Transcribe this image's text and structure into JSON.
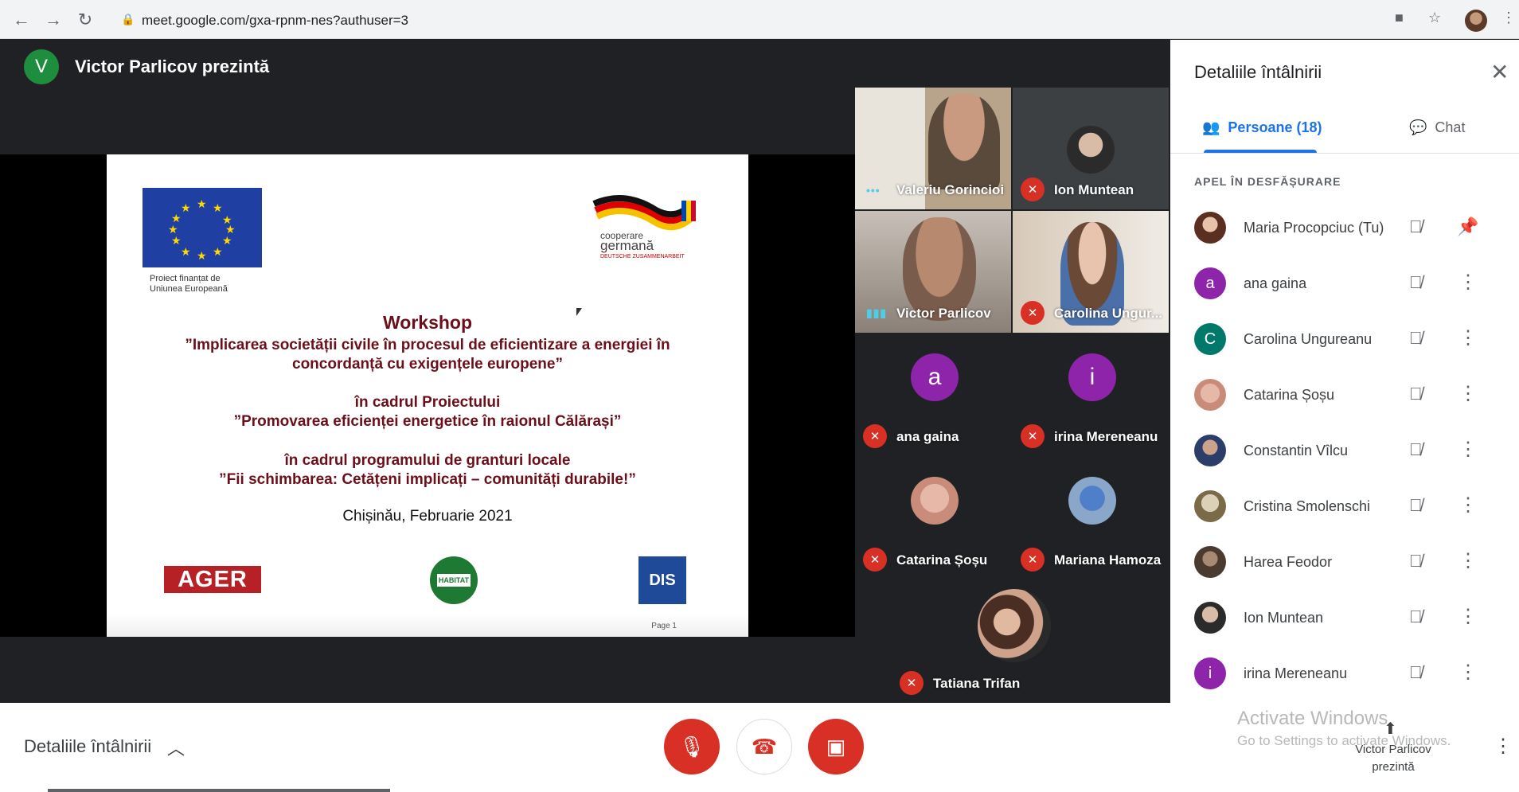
{
  "browser": {
    "url": "meet.google.com/gxa-rpnm-nes?authuser=3"
  },
  "presenter": {
    "initial": "V",
    "label": "Victor Parlicov prezintă"
  },
  "slide": {
    "eu_caption_line1": "Proiect finanțat de",
    "eu_caption_line2": "Uniunea Europeană",
    "ger_line1": "cooperare",
    "ger_line2": "germană",
    "ger_line3": "DEUTSCHE ZUSAMMENARBEIT",
    "workshop": "Workshop",
    "t1_line1": "”Implicarea societății civile în procesul de eficientizare a energiei în",
    "t1_line2": "concordanță cu exigențele europene”",
    "t2_line1": "în cadrul Proiectului",
    "t2_line2": "”Promovarea eficienței energetice în raionul Călărași”",
    "t3_line1": "în cadrul programului de granturi locale",
    "t3_line2": "”Fii schimbarea: Cetățeni implicați – comunități durabile!”",
    "date": "Chișinău, Februarie 2021",
    "logo_ager": "AGER",
    "logo_habitat": "HABITAT",
    "logo_dis": "DIS",
    "page": "Page 1"
  },
  "tiles": [
    {
      "name": "Valeriu Gorincioi"
    },
    {
      "name": "Ion Muntean"
    },
    {
      "name": "Victor Parlicov"
    },
    {
      "name": "Carolina Ungur..."
    },
    {
      "name": "ana gaina",
      "initial": "a"
    },
    {
      "name": "irina Mereneanu",
      "initial": "i"
    },
    {
      "name": "Catarina Șoșu"
    },
    {
      "name": "Mariana Hamoza"
    },
    {
      "name": "Tatiana Trifan"
    }
  ],
  "bottom": {
    "details_label": "Detaliile întâlnirii",
    "activate_title": "Activate Windows",
    "activate_sub": "Go to Settings to activate Windows.",
    "present_line1": "Victor Parlicov",
    "present_line2": "prezintă"
  },
  "panel": {
    "title": "Detaliile întâlnirii",
    "tab_people": "Persoane (18)",
    "tab_chat": "Chat",
    "section": "APEL ÎN DESFĂȘURARE",
    "people": [
      {
        "name": "Maria Procopciuc (Tu)"
      },
      {
        "name": "ana gaina",
        "initial": "a"
      },
      {
        "name": "Carolina Ungureanu",
        "initial": "C"
      },
      {
        "name": "Catarina Șoșu"
      },
      {
        "name": "Constantin Vîlcu"
      },
      {
        "name": "Cristina Smolenschi"
      },
      {
        "name": "Harea Feodor"
      },
      {
        "name": "Ion Muntean"
      },
      {
        "name": "irina Mereneanu",
        "initial": "i"
      }
    ]
  },
  "colors": {
    "meet_bg": "#202124",
    "accent_blue": "#1a73e8",
    "danger_red": "#d93025",
    "avatar_purple": "#8e24aa",
    "avatar_teal": "#00796b",
    "presenter_green": "#1e8e3e"
  }
}
